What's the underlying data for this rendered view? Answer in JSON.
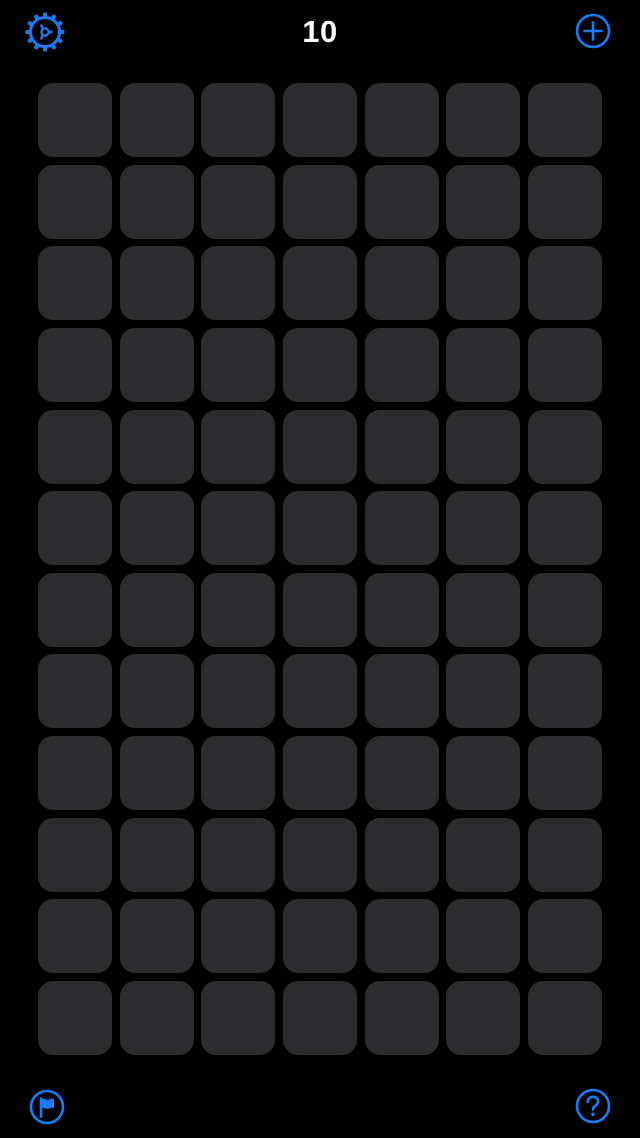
{
  "header": {
    "counter": "10",
    "settings_icon": "gear-icon",
    "add_icon": "plus-circle-icon"
  },
  "board": {
    "rows": 12,
    "columns": 7,
    "cell_state": "covered",
    "cell_color": "#2c2c2f"
  },
  "footer": {
    "flag_icon": "flag-circle-icon",
    "help_icon": "question-circle-icon"
  },
  "colors": {
    "background": "#000000",
    "accent": "#1a7cf5",
    "text": "#ffffff"
  }
}
